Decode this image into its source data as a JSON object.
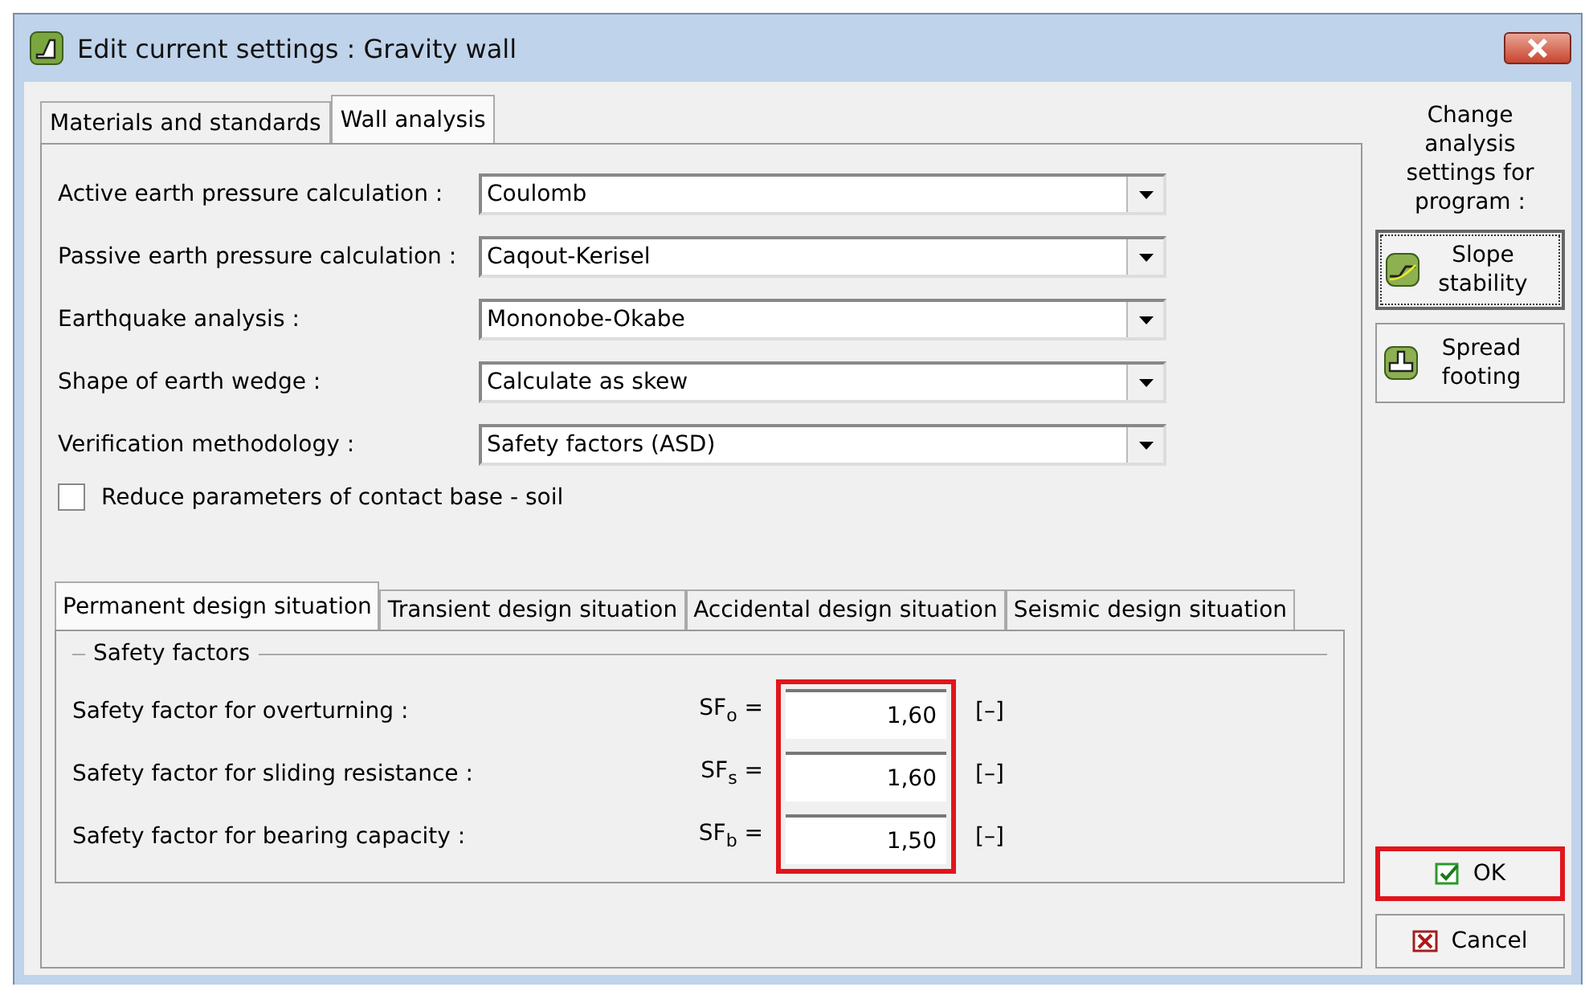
{
  "window": {
    "title": "Edit current settings : Gravity wall"
  },
  "tabs": [
    {
      "label": "Materials and standards",
      "selected": false
    },
    {
      "label": "Wall analysis",
      "selected": true
    }
  ],
  "settings": [
    {
      "label": "Active earth pressure calculation :",
      "value": "Coulomb"
    },
    {
      "label": "Passive earth pressure calculation :",
      "value": "Caqout-Kerisel"
    },
    {
      "label": "Earthquake analysis :",
      "value": "Mononobe-Okabe"
    },
    {
      "label": "Shape of earth wedge :",
      "value": "Calculate as skew"
    },
    {
      "label": "Verification methodology :",
      "value": "Safety factors (ASD)"
    }
  ],
  "reduce_checkbox": {
    "label": "Reduce parameters of contact base - soil",
    "checked": false
  },
  "situation_tabs": [
    {
      "label": "Permanent design situation",
      "selected": true
    },
    {
      "label": "Transient design situation",
      "selected": false
    },
    {
      "label": "Accidental design situation",
      "selected": false
    },
    {
      "label": "Seismic design situation",
      "selected": false
    }
  ],
  "safety_factors": {
    "title": "Safety factors",
    "highlighted": true,
    "rows": [
      {
        "label": "Safety factor for overturning :",
        "symbol": "SF$_{o}$ =",
        "value": "1,60",
        "unit": "[–]"
      },
      {
        "label": "Safety factor for sliding resistance :",
        "symbol": "SF$_{s}$ =",
        "value": "1,60",
        "unit": "[–]"
      },
      {
        "label": "Safety factor for bearing capacity :",
        "symbol": "SF$_{b}$ =",
        "value": "1,50",
        "unit": "[–]"
      }
    ]
  },
  "sidebar": {
    "caption": "Change analysis settings for program :",
    "programs": [
      {
        "label": "Slope stability",
        "kind": "slope",
        "focused": true
      },
      {
        "label": "Spread footing",
        "kind": "footing",
        "focused": false
      }
    ]
  },
  "buttons": [
    {
      "label": "OK",
      "kind": "ok",
      "highlighted": true
    },
    {
      "label": "Cancel",
      "kind": "cancel",
      "highlighted": false
    }
  ]
}
